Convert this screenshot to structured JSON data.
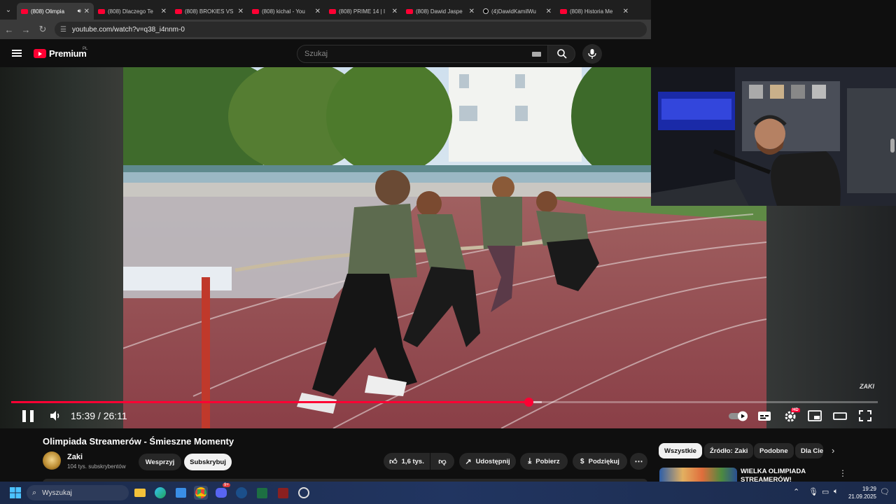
{
  "browser": {
    "tabs": [
      {
        "title": "(808) Olimpia",
        "active": true,
        "icon": "youtube-icon"
      },
      {
        "title": "(808) Dlaczego Te",
        "icon": "youtube-icon"
      },
      {
        "title": "(808) BROKIES VS",
        "icon": "youtube-icon"
      },
      {
        "title": "(808) kichal - You",
        "icon": "youtube-icon"
      },
      {
        "title": "(808) PRIME 14 | I",
        "icon": "youtube-icon"
      },
      {
        "title": "(808) Dawid Jaspe",
        "icon": "youtube-icon"
      },
      {
        "title": "(4)DawidKamilWu",
        "icon": "tiktok-icon"
      },
      {
        "title": "(808) Historia Me",
        "icon": "youtube-icon"
      }
    ],
    "url": "youtube.com/watch?v=q38_i4nnm-0"
  },
  "youtube": {
    "logo_text": "Premium",
    "logo_region": "PL",
    "search_placeholder": "Szukaj"
  },
  "player": {
    "time_display": "15:39 / 26:11",
    "progress": 0.5977,
    "buffered": 0.612,
    "watermark": "ZAKI",
    "hd_badge": "HD"
  },
  "video": {
    "title": "Olimpiada Streamerów - Śmieszne Momenty",
    "channel": "Zaki",
    "subscribers": "104 tys. subskrybentów",
    "support_label": "Wesprzyj",
    "subscribe_label": "Subskrybuj",
    "like_count": "1,6 tys.",
    "share_label": "Udostępnij",
    "download_label": "Pobierz",
    "thanks_label": "Podziękuj"
  },
  "sidebar": {
    "chips": [
      "Wszystkie",
      "Źródło: Zaki",
      "Podobne",
      "Dla Cie"
    ],
    "recommended_title": "WIELKA OLIMPIADA STREAMERÓW!"
  },
  "taskbar": {
    "search_placeholder": "Wyszukaj",
    "time": "19:29",
    "date": "21.09.2025",
    "notification_badge": "9+"
  },
  "colors": {
    "youtube_red": "#ff0033",
    "background": "#0f0f0f",
    "chip_bg": "#272727"
  }
}
